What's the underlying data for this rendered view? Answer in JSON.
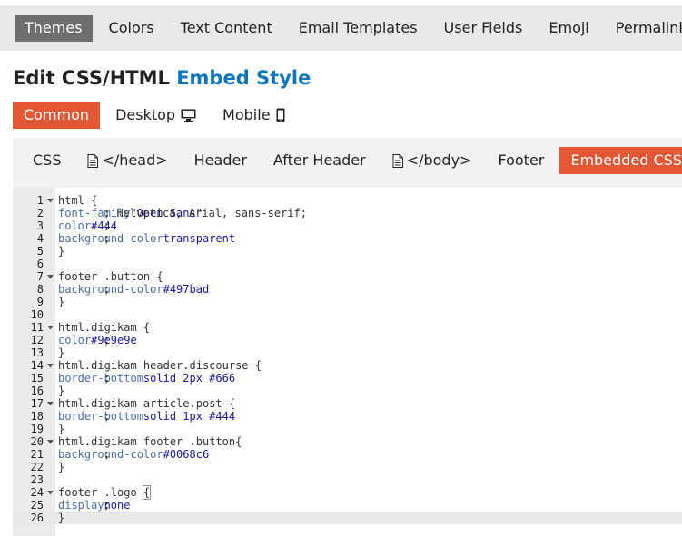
{
  "top_nav": {
    "items": [
      "Themes",
      "Colors",
      "Text Content",
      "Email Templates",
      "User Fields",
      "Emoji",
      "Permalinks"
    ],
    "active_index": 0
  },
  "title": {
    "prefix": "Edit CSS/HTML",
    "name": "Embed Style"
  },
  "modes": {
    "common": "Common",
    "desktop": "Desktop",
    "mobile": "Mobile",
    "active": "Common"
  },
  "tabs": {
    "css": "CSS",
    "head": "</head>",
    "header": "Header",
    "after_header": "After Header",
    "body": "</body>",
    "footer": "Footer",
    "embedded_css": "Embedded CSS",
    "active": "Embedded CSS"
  },
  "editor": {
    "current_line": 26,
    "lines": [
      {
        "n": "1",
        "fold": true,
        "tokens": [
          [
            "sel",
            "html "
          ],
          [
            "brace",
            "{"
          ]
        ]
      },
      {
        "n": "2",
        "tokens": [
          [
            "txt",
            "    "
          ],
          [
            "prop",
            "font-family"
          ],
          [
            "txt",
            ": "
          ],
          [
            "str",
            "\"Open Sans\""
          ],
          [
            "txt",
            ", Helvetica, Arial, sans-serif;"
          ]
        ]
      },
      {
        "n": "3",
        "tokens": [
          [
            "txt",
            "    "
          ],
          [
            "prop",
            "color"
          ],
          [
            "txt",
            ": "
          ],
          [
            "val",
            "#444"
          ],
          [
            "txt",
            ";"
          ]
        ]
      },
      {
        "n": "4",
        "tokens": [
          [
            "txt",
            "    "
          ],
          [
            "prop",
            "background-color"
          ],
          [
            "txt",
            ": "
          ],
          [
            "val",
            "transparent"
          ],
          [
            "txt",
            ";"
          ]
        ]
      },
      {
        "n": "5",
        "tokens": [
          [
            "brace",
            "}"
          ]
        ]
      },
      {
        "n": "6",
        "tokens": []
      },
      {
        "n": "7",
        "fold": true,
        "tokens": [
          [
            "sel",
            "footer .button "
          ],
          [
            "brace",
            "{"
          ]
        ]
      },
      {
        "n": "8",
        "tokens": [
          [
            "txt",
            "    "
          ],
          [
            "prop",
            "background-color"
          ],
          [
            "txt",
            ": "
          ],
          [
            "val",
            "#497bad"
          ],
          [
            "txt",
            ";"
          ]
        ]
      },
      {
        "n": "9",
        "tokens": [
          [
            "brace",
            "}"
          ]
        ]
      },
      {
        "n": "10",
        "tokens": []
      },
      {
        "n": "11",
        "fold": true,
        "tokens": [
          [
            "sel",
            "html.digikam "
          ],
          [
            "brace",
            "{"
          ]
        ]
      },
      {
        "n": "12",
        "tokens": [
          [
            "txt",
            "    "
          ],
          [
            "prop",
            "color"
          ],
          [
            "txt",
            ": "
          ],
          [
            "val",
            "#9e9e9e"
          ],
          [
            "txt",
            ";"
          ]
        ]
      },
      {
        "n": "13",
        "tokens": [
          [
            "brace",
            "}"
          ]
        ]
      },
      {
        "n": "14",
        "fold": true,
        "tokens": [
          [
            "sel",
            "html.digikam header.discourse "
          ],
          [
            "brace",
            "{"
          ]
        ]
      },
      {
        "n": "15",
        "tokens": [
          [
            "txt",
            "    "
          ],
          [
            "prop",
            "border-bottom"
          ],
          [
            "txt",
            ": "
          ],
          [
            "val",
            "solid 2px #666"
          ],
          [
            "txt",
            ";"
          ]
        ]
      },
      {
        "n": "16",
        "tokens": [
          [
            "brace",
            "}"
          ]
        ]
      },
      {
        "n": "17",
        "fold": true,
        "tokens": [
          [
            "sel",
            "html.digikam article.post "
          ],
          [
            "brace",
            "{"
          ]
        ]
      },
      {
        "n": "18",
        "tokens": [
          [
            "txt",
            "    "
          ],
          [
            "prop",
            "border-bottom"
          ],
          [
            "txt",
            ": "
          ],
          [
            "val",
            "solid 1px #444"
          ],
          [
            "txt",
            ";"
          ]
        ]
      },
      {
        "n": "19",
        "tokens": [
          [
            "brace",
            "}"
          ]
        ]
      },
      {
        "n": "20",
        "fold": true,
        "tokens": [
          [
            "sel",
            "html.digikam footer .button"
          ],
          [
            "brace",
            "{"
          ]
        ]
      },
      {
        "n": "21",
        "tokens": [
          [
            "txt",
            "    "
          ],
          [
            "prop",
            "background-color"
          ],
          [
            "txt",
            ": "
          ],
          [
            "val",
            "#0068c6"
          ],
          [
            "txt",
            ";"
          ]
        ]
      },
      {
        "n": "22",
        "tokens": [
          [
            "brace",
            "}"
          ]
        ]
      },
      {
        "n": "23",
        "tokens": []
      },
      {
        "n": "24",
        "fold": true,
        "tokens": [
          [
            "sel",
            "footer .logo "
          ],
          [
            "cursorbox",
            "{"
          ]
        ]
      },
      {
        "n": "25",
        "tokens": [
          [
            "txt",
            "    "
          ],
          [
            "prop",
            "display"
          ],
          [
            "txt",
            ": "
          ],
          [
            "val",
            "none"
          ],
          [
            "txt",
            ";"
          ]
        ]
      },
      {
        "n": "26",
        "tokens": [
          [
            "brace",
            "}"
          ]
        ]
      }
    ]
  },
  "colors": {
    "accent_orange": "#e45735",
    "title_blue": "#0e76bd",
    "nav_active_bg": "#6e6e6e"
  }
}
